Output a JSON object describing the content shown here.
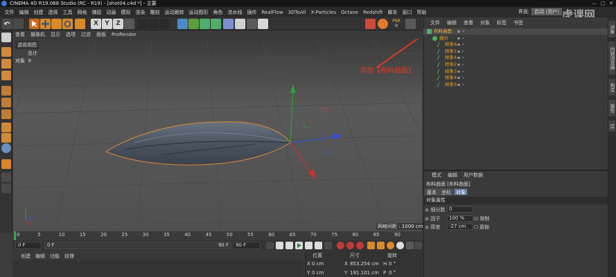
{
  "window": {
    "title": "CINEMA 4D R19.068 Studio (RC - R19) - [shot04.c4d *] - 主要",
    "controls": [
      "—",
      "□",
      "✕"
    ]
  },
  "menubar": {
    "items": [
      "文件",
      "编辑",
      "创建",
      "选择",
      "工具",
      "网格",
      "捕捉",
      "动画",
      "模拟",
      "渲染",
      "雕刻",
      "运动跟踪",
      "运动图形",
      "角色",
      "流水线",
      "插件",
      "RealFlow",
      "3DToAll",
      "X-Particles",
      "Octane",
      "Redshift",
      "脚本",
      "窗口",
      "帮助"
    ],
    "layout_label": "界面:",
    "layout_value": "启动 (用户)"
  },
  "watermark": "虎课网",
  "viewport": {
    "menu": [
      "查看",
      "摄像机",
      "显示",
      "选项",
      "过滤",
      "面板",
      "ProRender"
    ],
    "label": "透视视图",
    "stats_total": "总计",
    "stats_objects_label": "对象",
    "stats_objects_value": "9",
    "grid_spacing": "网格间距 : 1000 cm",
    "annotation": "添加【布料曲面】"
  },
  "timeline": {
    "ticks": [
      "0",
      "5",
      "10",
      "15",
      "20",
      "25",
      "30",
      "35",
      "40",
      "45",
      "50",
      "55",
      "60",
      "65",
      "70",
      "75",
      "80",
      "85",
      "90"
    ],
    "current_frame": "0 F",
    "start_frame": "0 F",
    "end_frame_slider": "90 F",
    "end_frame": "90 F",
    "frame_marker": "0 F"
  },
  "material_panel": {
    "menu": [
      "创建",
      "编辑",
      "功能",
      "纹理"
    ]
  },
  "coordinates": {
    "headers": [
      "位置",
      "尺寸",
      "旋转"
    ],
    "rows": [
      {
        "axis": "X",
        "pos": "0 cm",
        "size_axis": "X",
        "size": "853.254 cm",
        "rot_axis": "H",
        "rot": "0 °"
      },
      {
        "axis": "Y",
        "pos": "0 cm",
        "size_axis": "Y",
        "size": "191.101 cm",
        "rot_axis": "P",
        "rot": "0 °"
      }
    ]
  },
  "object_manager": {
    "menu": [
      "文件",
      "编辑",
      "查看",
      "对象",
      "标签",
      "书签"
    ],
    "objects": [
      {
        "name": "布料曲面",
        "indent": 0,
        "selected": true
      },
      {
        "name": "细分",
        "indent": 1,
        "selected": false
      },
      {
        "name": "样条6",
        "indent": 2,
        "selected": false
      },
      {
        "name": "样条1",
        "indent": 2,
        "selected": false
      },
      {
        "name": "样条4",
        "indent": 2,
        "selected": false
      },
      {
        "name": "样条2",
        "indent": 2,
        "selected": false
      },
      {
        "name": "样条3",
        "indent": 2,
        "selected": false
      },
      {
        "name": "样条4",
        "indent": 2,
        "selected": false
      },
      {
        "name": "样条5",
        "indent": 2,
        "selected": false
      }
    ]
  },
  "attributes": {
    "menu": [
      "模式",
      "编辑",
      "用户数据"
    ],
    "title": "布料曲面 [布料曲面]",
    "tabs": [
      "基本",
      "坐标",
      "对象"
    ],
    "active_tab": "对象",
    "section": "对象属性",
    "fields": [
      {
        "label": "细分数",
        "value": "0"
      },
      {
        "label": "因子",
        "value": "100 %",
        "extra_label": "限制"
      },
      {
        "label": "厚度",
        "value": "-27 cm",
        "extra_label": "膨胀"
      }
    ]
  },
  "right_tabs": [
    "对象",
    "内容浏览器",
    "构造",
    "属性",
    "层"
  ],
  "colors": {
    "accent_orange": "#e8a21d",
    "selection_blue": "#5d7fa8",
    "annotation_red": "#e03a22"
  }
}
